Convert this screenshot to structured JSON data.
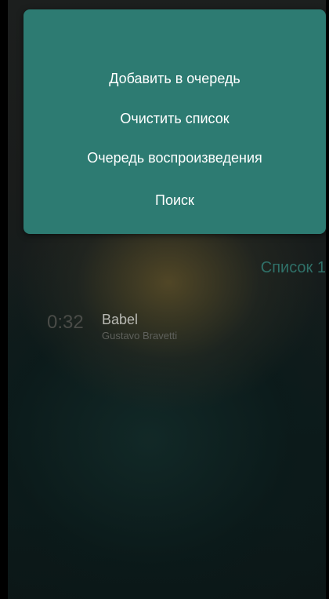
{
  "menu": {
    "items": [
      {
        "label": "Добавить в очередь"
      },
      {
        "label": "Очистить список"
      },
      {
        "label": "Очередь воспроизведения"
      },
      {
        "label": "Поиск"
      }
    ]
  },
  "playlist": {
    "title": "Список 1",
    "tracks": [
      {
        "time": "0:32",
        "title": "Babel",
        "artist": "Gustavo Bravetti"
      }
    ]
  },
  "colors": {
    "menu_background": "#2d7b72",
    "accent_text": "#2f7068"
  }
}
